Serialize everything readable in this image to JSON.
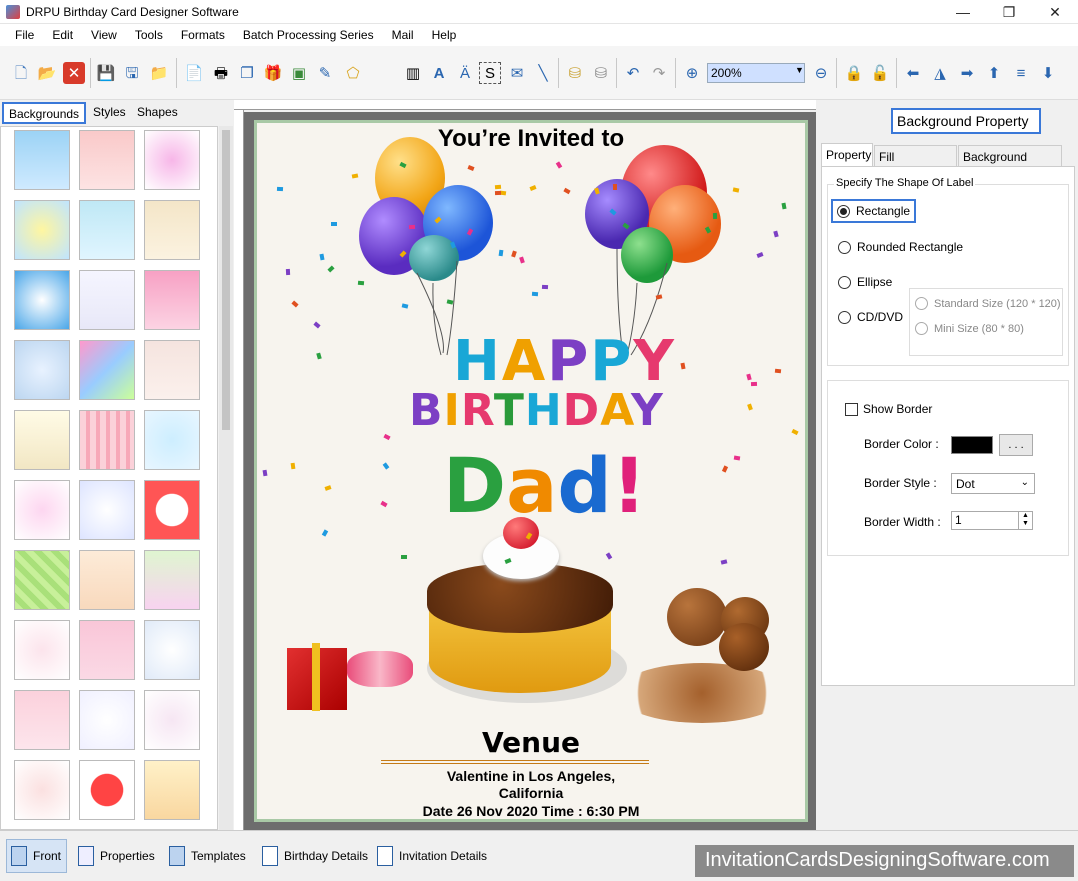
{
  "window": {
    "title": "DRPU Birthday Card Designer Software",
    "controls": [
      "—",
      "❐",
      "✕"
    ]
  },
  "menu": [
    "File",
    "Edit",
    "View",
    "Tools",
    "Formats",
    "Batch Processing Series",
    "Mail",
    "Help"
  ],
  "toolbar": {
    "zoom_value": "200%",
    "icons": [
      "new-icon",
      "open-icon",
      "close-icon",
      "save-icon",
      "save-as-icon",
      "export-icon",
      "properties-icon",
      "print-icon",
      "copy-icon",
      "clipart-icon",
      "image-icon",
      "pencil-icon",
      "shape-icon",
      "barcode-icon",
      "text-icon",
      "word-art-icon",
      "signature-icon",
      "mail-icon",
      "line-icon",
      "database-icon",
      "database-gray-icon",
      "undo-icon",
      "redo-icon",
      "zoom-in-icon",
      "zoom-out-icon",
      "lock-icon",
      "unlock-icon",
      "arrow-left-icon",
      "flip-icon",
      "arrow-right-icon",
      "arrow-up-icon",
      "align-icon",
      "arrow-down-icon"
    ]
  },
  "left_panel": {
    "tabs": [
      "Backgrounds",
      "Styles",
      "Shapes"
    ],
    "active_tab": "Backgrounds",
    "thumbnail_count": 30
  },
  "card": {
    "invited": "You’re Invited to",
    "happy": "HAPPY",
    "birthday": "BIRTHDAY",
    "dad": "Dad!",
    "venue": "Venue",
    "address_line1": "Valentine in Los Angeles,",
    "address_line2": "California",
    "date_time": "Date 26 Nov 2020   Time : 6:30 PM"
  },
  "right_panel": {
    "title": "Background Property",
    "tabs": [
      "Property",
      "Fill Background",
      "Background Effects"
    ],
    "shape_group_label": "Specify The Shape Of Label",
    "shape_options": [
      "Rectangle",
      "Rounded Rectangle",
      "Ellipse",
      "CD/DVD"
    ],
    "selected_shape": "Rectangle",
    "cd_sizes": [
      "Standard Size (120 * 120)",
      "Mini Size (80 * 80)"
    ],
    "show_border_label": "Show Border",
    "show_border": false,
    "border_color_label": "Border Color :",
    "border_color": "#000000",
    "dots_label": ". . .",
    "border_style_label": "Border Style :",
    "border_style": "Dot",
    "border_width_label": "Border Width :",
    "border_width": "1"
  },
  "bottom_tabs": [
    "Front",
    "Properties",
    "Templates",
    "Birthday Details",
    "Invitation Details"
  ],
  "active_bottom_tab": "Front",
  "brand": "InvitationCardsDesigningSoftware.com"
}
